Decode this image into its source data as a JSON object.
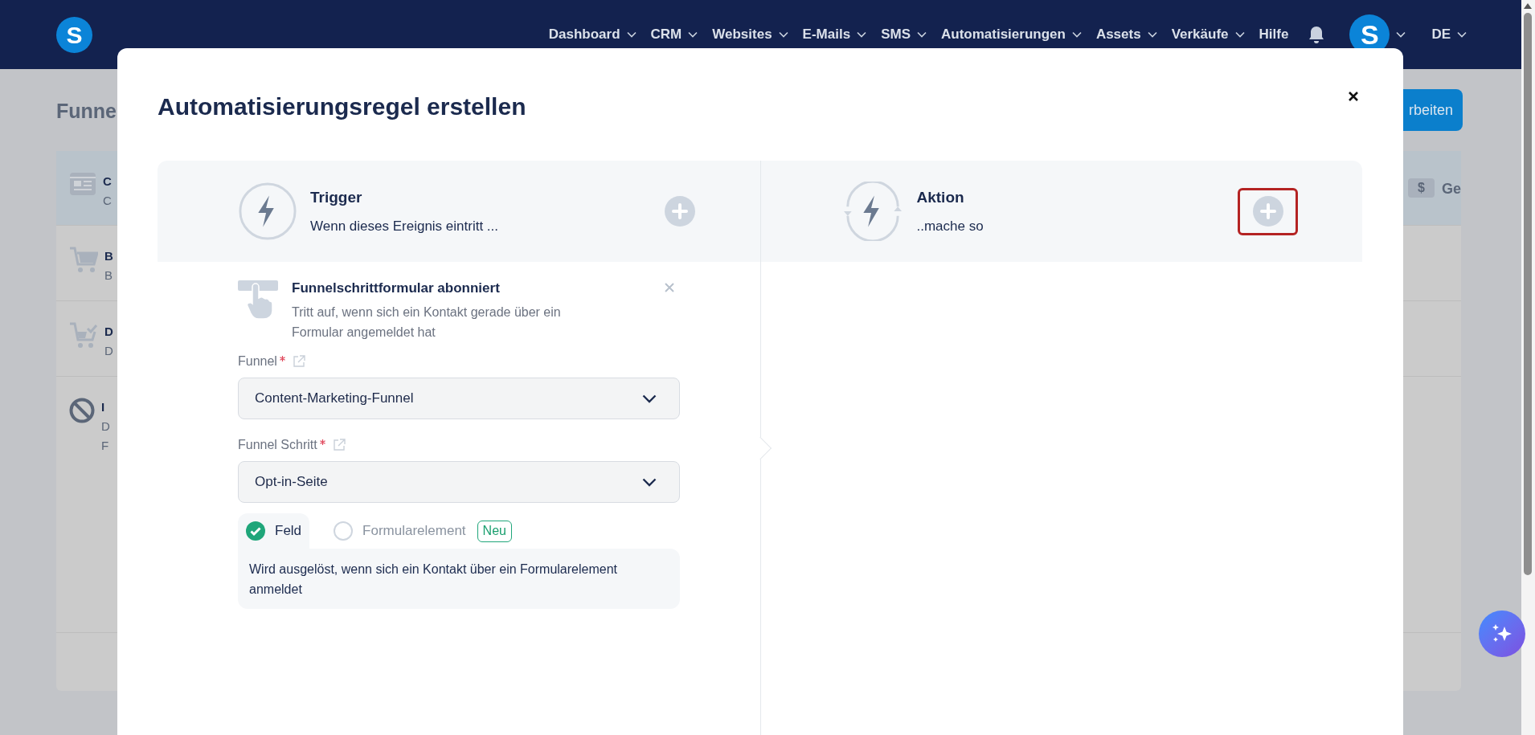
{
  "nav": {
    "logo": "S",
    "items": [
      {
        "label": "Dashboard",
        "has_menu": true
      },
      {
        "label": "CRM",
        "has_menu": true
      },
      {
        "label": "Websites",
        "has_menu": true
      },
      {
        "label": "E-Mails",
        "has_menu": true
      },
      {
        "label": "SMS",
        "has_menu": true
      },
      {
        "label": "Automatisierungen",
        "has_menu": true
      },
      {
        "label": "Assets",
        "has_menu": true
      },
      {
        "label": "Verkäufe",
        "has_menu": true
      },
      {
        "label": "Hilfe",
        "has_menu": false
      }
    ],
    "avatar": "S",
    "language": "DE"
  },
  "background_page": {
    "title": "Funne",
    "rows": [
      {
        "kind": "card",
        "title": "C",
        "lines": [
          "C"
        ],
        "selected": true
      },
      {
        "kind": "cart",
        "title": "B",
        "lines": [
          "B"
        ],
        "selected": false
      },
      {
        "kind": "cart-check",
        "title": "D",
        "lines": [
          "D"
        ],
        "selected": false
      },
      {
        "kind": "blocked",
        "title": "I",
        "lines": [
          "D",
          "F"
        ],
        "selected": false
      }
    ],
    "edit_button": "rbeiten",
    "badge": "$",
    "tab_label": "Ge"
  },
  "modal": {
    "title": "Automatisierungsregel erstellen",
    "trigger": {
      "title": "Trigger",
      "subtitle": "Wenn dieses Ereignis eintritt ..."
    },
    "action": {
      "title": "Aktion",
      "subtitle": "..mache so",
      "highlighted": true
    },
    "event": {
      "title": "Funnelschrittformular abonniert",
      "description": "Tritt auf, wenn sich ein Kontakt gerade über ein Formular angemeldet hat"
    },
    "fields": [
      {
        "label": "Funnel",
        "required": true,
        "value": "Content-Marketing-Funnel"
      },
      {
        "label": "Funnel Schritt",
        "required": true,
        "value": "Opt-in-Seite"
      }
    ],
    "options": [
      {
        "label": "Feld",
        "selected": true
      },
      {
        "label": "Formularelement",
        "selected": false,
        "badge": "Neu"
      }
    ],
    "option_description": "Wird ausgelöst, wenn sich ein Kontakt über ein Formularelement anmeldet"
  }
}
